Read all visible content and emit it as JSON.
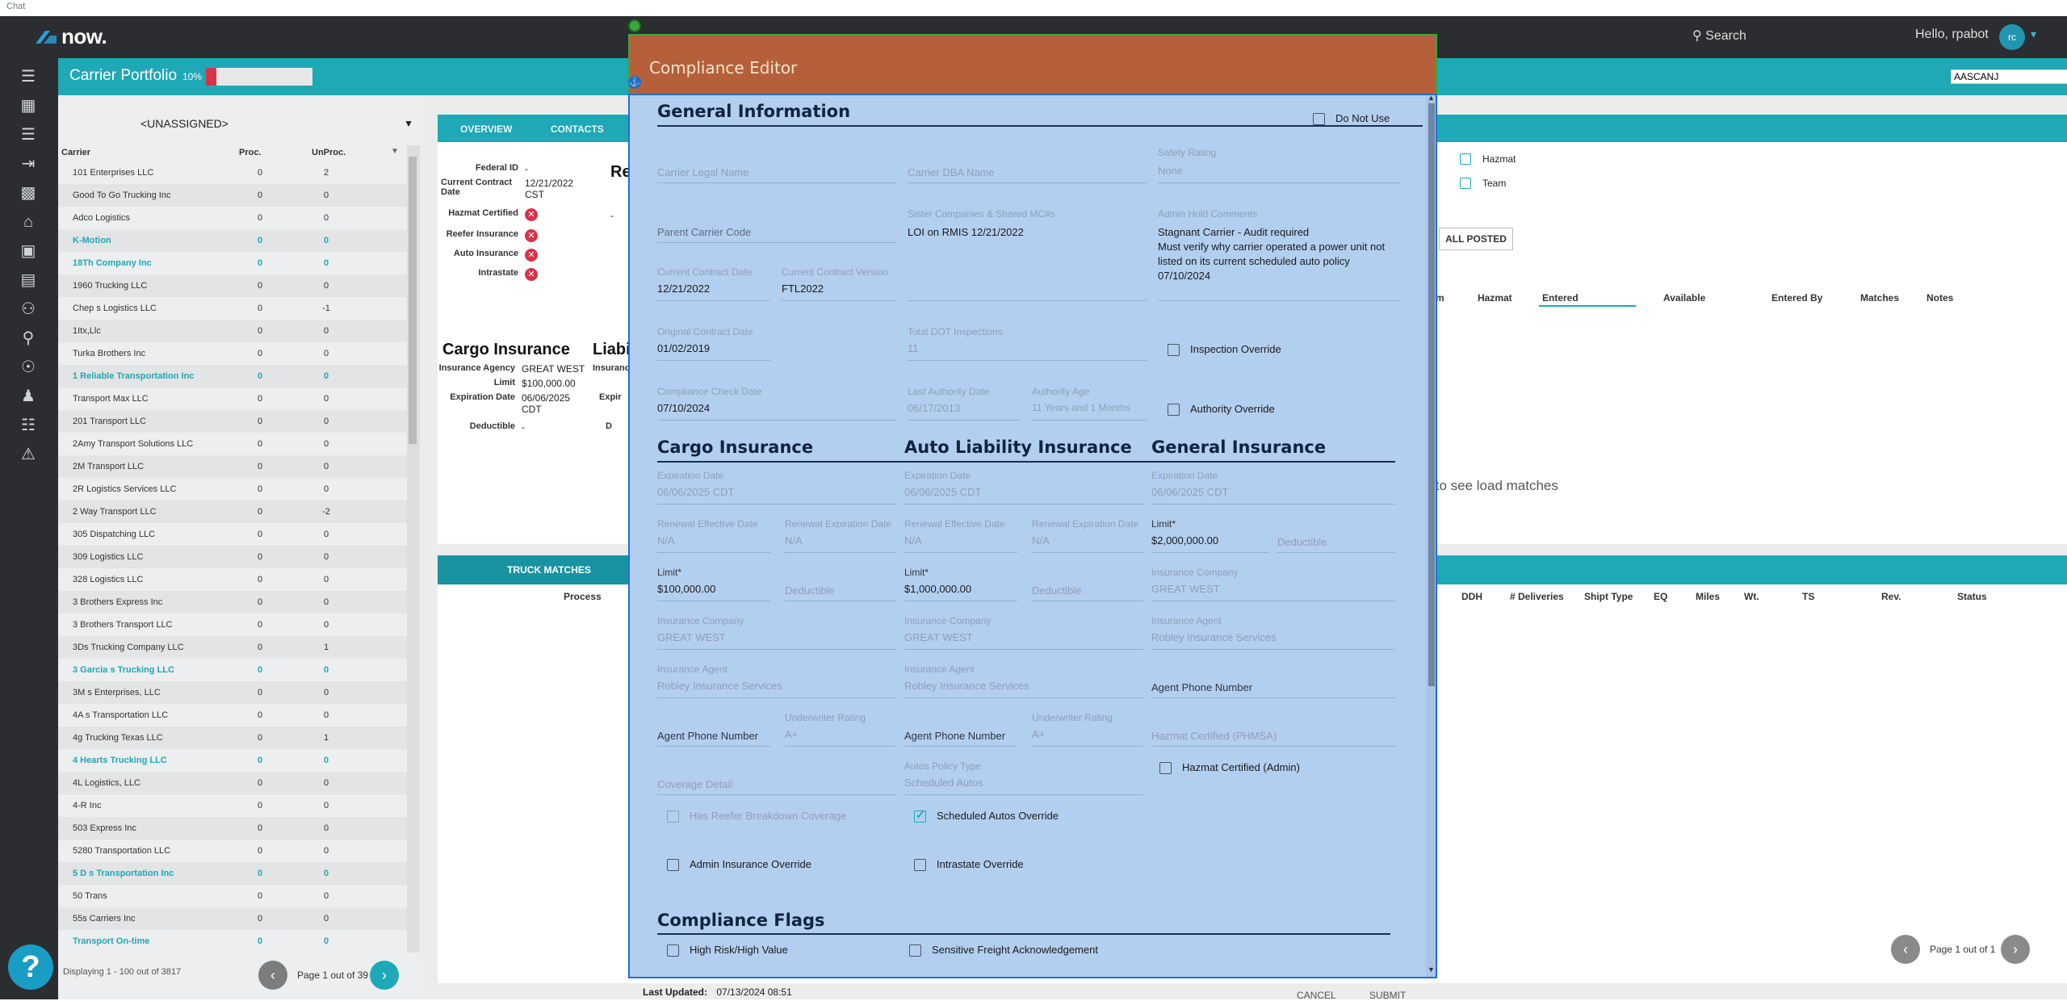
{
  "topstrip": {
    "text": "Chat"
  },
  "topbar": {
    "logo": "now.",
    "search_label": "Search",
    "greeting": "Hello, rpabot",
    "avatar_initials": "rc"
  },
  "rail": {
    "icons": [
      "menu-icon",
      "dashboard-icon",
      "list-icon",
      "login-icon",
      "building-icon",
      "warehouse-icon",
      "boxes-icon",
      "map-icon",
      "people-icon",
      "location-search-icon",
      "search-circle-icon",
      "person-clock-icon",
      "book-icon",
      "warning-icon"
    ]
  },
  "portfolio": {
    "title": "Carrier Portfolio",
    "pct_label": "10%",
    "progress": 0.1,
    "search_value": "AASCANJ"
  },
  "list": {
    "assign_value": "<UNASSIGNED>",
    "headers": {
      "carrier": "Carrier",
      "proc": "Proc.",
      "unproc": "UnProc."
    },
    "rows": [
      {
        "name": "101 Enterprises LLC",
        "proc": "0",
        "unproc": "2",
        "link": false
      },
      {
        "name": "Good To Go Trucking Inc",
        "proc": "0",
        "unproc": "0",
        "link": false
      },
      {
        "name": "Adco Logistics",
        "proc": "0",
        "unproc": "0",
        "link": false
      },
      {
        "name": "K-Motion",
        "proc": "0",
        "unproc": "0",
        "link": true
      },
      {
        "name": "18Th Company Inc",
        "proc": "0",
        "unproc": "0",
        "link": true
      },
      {
        "name": "1960 Trucking LLC",
        "proc": "0",
        "unproc": "0",
        "link": false
      },
      {
        "name": "Chep s Logistics LLC",
        "proc": "0",
        "unproc": "-1",
        "link": false
      },
      {
        "name": "1Itx,Llc",
        "proc": "0",
        "unproc": "0",
        "link": false
      },
      {
        "name": "Turka Brothers Inc",
        "proc": "0",
        "unproc": "0",
        "link": false
      },
      {
        "name": "1 Reliable Transportation Inc",
        "proc": "0",
        "unproc": "0",
        "link": true
      },
      {
        "name": "Transport Max LLC",
        "proc": "0",
        "unproc": "0",
        "link": false
      },
      {
        "name": "201 Transport LLC",
        "proc": "0",
        "unproc": "0",
        "link": false
      },
      {
        "name": "2Amy Transport Solutions LLC",
        "proc": "0",
        "unproc": "0",
        "link": false
      },
      {
        "name": "2M Transport LLC",
        "proc": "0",
        "unproc": "0",
        "link": false
      },
      {
        "name": "2R Logistics Services LLC",
        "proc": "0",
        "unproc": "0",
        "link": false
      },
      {
        "name": "2 Way Transport LLC",
        "proc": "0",
        "unproc": "-2",
        "link": false
      },
      {
        "name": "305 Dispatching LLC",
        "proc": "0",
        "unproc": "0",
        "link": false
      },
      {
        "name": "309 Logistics LLC",
        "proc": "0",
        "unproc": "0",
        "link": false
      },
      {
        "name": "328 Logistics LLC",
        "proc": "0",
        "unproc": "0",
        "link": false
      },
      {
        "name": "3 Brothers Express Inc",
        "proc": "0",
        "unproc": "0",
        "link": false
      },
      {
        "name": "3 Brothers Transport LLC",
        "proc": "0",
        "unproc": "0",
        "link": false
      },
      {
        "name": "3Ds Trucking Company LLC",
        "proc": "0",
        "unproc": "1",
        "link": false
      },
      {
        "name": "3 Garcia s Trucking LLC",
        "proc": "0",
        "unproc": "0",
        "link": true
      },
      {
        "name": "3M s Enterprises, LLC",
        "proc": "0",
        "unproc": "0",
        "link": false
      },
      {
        "name": "4A s Transportation LLC",
        "proc": "0",
        "unproc": "0",
        "link": false
      },
      {
        "name": "4g Trucking Texas LLC",
        "proc": "0",
        "unproc": "1",
        "link": false
      },
      {
        "name": "4 Hearts Trucking LLC",
        "proc": "0",
        "unproc": "0",
        "link": true
      },
      {
        "name": "4L Logistics, LLC",
        "proc": "0",
        "unproc": "0",
        "link": false
      },
      {
        "name": "4-R Inc",
        "proc": "0",
        "unproc": "0",
        "link": false
      },
      {
        "name": "503 Express Inc",
        "proc": "0",
        "unproc": "0",
        "link": false
      },
      {
        "name": "5280 Transportation LLC",
        "proc": "0",
        "unproc": "0",
        "link": false
      },
      {
        "name": "5 D s Transportation Inc",
        "proc": "0",
        "unproc": "0",
        "link": true
      },
      {
        "name": "50 Trans",
        "proc": "0",
        "unproc": "0",
        "link": false
      },
      {
        "name": "55s Carriers Inc",
        "proc": "0",
        "unproc": "0",
        "link": false
      },
      {
        "name": "Transport On-time",
        "proc": "0",
        "unproc": "0",
        "link": true
      }
    ],
    "footer": "Displaying 1 - 100 out of 3817",
    "page_label": "Page 1 out of 39"
  },
  "detail": {
    "tabs": [
      "OVERVIEW",
      "CONTACTS"
    ],
    "fields": [
      {
        "k": "Federal ID",
        "v": "-"
      },
      {
        "k": "Current Contract Date",
        "v": "12/21/2022 CST"
      },
      {
        "k": "Hazmat Certified",
        "v": ""
      },
      {
        "k": "Reefer Insurance",
        "v": ""
      },
      {
        "k": "Auto Insurance",
        "v": ""
      },
      {
        "k": "Intrastate",
        "v": ""
      }
    ],
    "recent_heading": "Rece",
    "dash": "-",
    "cargo_heading": "Cargo Insurance",
    "liab_heading": "Liabi",
    "insurance_label": "Insurance",
    "expiration_short": "Expir",
    "d_short": "D",
    "cargo_fields": [
      {
        "k": "Insurance Agency",
        "v": "GREAT WEST"
      },
      {
        "k": "Limit",
        "v": "$100,000.00"
      },
      {
        "k": "Expiration Date",
        "v": "06/06/2025 CDT"
      },
      {
        "k": "Deductible",
        "v": "-"
      }
    ],
    "hazmat_label": "Hazmat",
    "team_label": "Team",
    "all_posted": "ALL POSTED",
    "load_columns": [
      "m",
      "Hazmat",
      "Entered",
      "Available",
      "Entered By",
      "Matches",
      "Notes"
    ],
    "load_hint": "ks to see load matches",
    "truck_tab": "TRUCK MATCHES",
    "truck_columns": [
      "Process",
      "DDH",
      "# Deliveries",
      "Shipt Type",
      "EQ",
      "Miles",
      "Wt.",
      "TS",
      "Rev.",
      "Status"
    ],
    "truck_page": "Page 1 out of 1"
  },
  "modal": {
    "title": "Compliance Editor",
    "general_heading": "General Information",
    "do_not_use": "Do Not Use",
    "carrier_legal_name": "Carrier Legal Name",
    "carrier_dba_name": "Carrier DBA Name",
    "safety_rating_label": "Safety Rating",
    "safety_rating_value": "None",
    "parent_carrier_code": "Parent Carrier Code",
    "sister_label": "Sister Companies & Shared MC#s",
    "sister_value": "LOI on RMIS 12/21/2022",
    "admin_hold_label": "Admin Hold Comments",
    "admin_hold_line1": "Stagnant Carrier - Audit required",
    "admin_hold_line2": "Must verify why carrier operated a power unit not",
    "admin_hold_line3": "listed on its current scheduled auto policy",
    "admin_hold_line4": "07/10/2024",
    "contract_date_label": "Current Contract Date",
    "contract_date_value": "12/21/2022",
    "contract_version_label": "Current Contract Version",
    "contract_version_value": "FTL2022",
    "original_contract_label": "Original Contract Date",
    "original_contract_value": "01/02/2019",
    "dot_label": "Total DOT Inspections",
    "dot_value": "11",
    "inspection_override": "Inspection Override",
    "check_date_label": "Compliance Check Date",
    "check_date_value": "07/10/2024",
    "last_authority_label": "Last Authority Date",
    "last_authority_value": "06/17/2013",
    "authority_age_label": "Authority Age",
    "authority_age_value": "11 Years and 1 Months",
    "authority_override": "Authority Override",
    "cargo_heading": "Cargo Insurance",
    "auto_heading": "Auto Liability Insurance",
    "general_ins_heading": "General Insurance",
    "expiration_label": "Expiration Date",
    "cargo_exp": "06/06/2025 CDT",
    "auto_exp": "06/06/2025 CDT",
    "general_exp": "06/06/2025 CDT",
    "renewal_eff_label": "Renewal Effective Date",
    "renewal_exp_label": "Renewal Expiration Date",
    "na": "N/A",
    "limit_label": "Limit*",
    "general_limit": "$2,000,000.00",
    "deductible": "Deductible",
    "cargo_limit": "$100,000.00",
    "auto_limit": "$1,000,000.00",
    "insurance_company_label": "Insurance Company",
    "general_company": "GREAT WEST",
    "cargo_company": "GREAT WEST",
    "auto_company": "GREAT WEST",
    "insurance_agent_label": "Insurance Agent",
    "general_agent": "Robley Insurance Services",
    "cargo_agent": "Robley Insurance Services",
    "auto_agent": "Robley Insurance Services",
    "agent_phone": "Agent Phone Number",
    "underwriter_label": "Underwriter Rating",
    "cargo_underwriter": "A+",
    "auto_underwriter": "A+",
    "hazmat_phmsa": "Hazmat Certified (PHMSA)",
    "hazmat_admin": "Hazmat Certified (Admin)",
    "coverage_detail": "Coverage Detail",
    "autos_policy_label": "Autos Policy Type",
    "autos_policy_value": "Scheduled Autos",
    "reefer_breakdown": "Has Reefer Breakdown Coverage",
    "scheduled_autos_override": "Scheduled Autos Override",
    "admin_insurance_override": "Admin Insurance Override",
    "intrastate_override": "Intrastate Override",
    "flags_heading": "Compliance Flags",
    "high_risk": "High Risk/High Value",
    "sensitive_freight": "Sensitive Freight Acknowledgement"
  },
  "under_modal": {
    "last_updated_label": "Last Updated:",
    "last_updated_value": "07/13/2024 08:51",
    "cancel": "CANCEL",
    "submit": "SUBMIT"
  },
  "colors": {
    "teal": "#1fa8b5",
    "modal_header": "#b5603a",
    "modal_body": "#b3cff0",
    "dark": "#2b2d30"
  }
}
